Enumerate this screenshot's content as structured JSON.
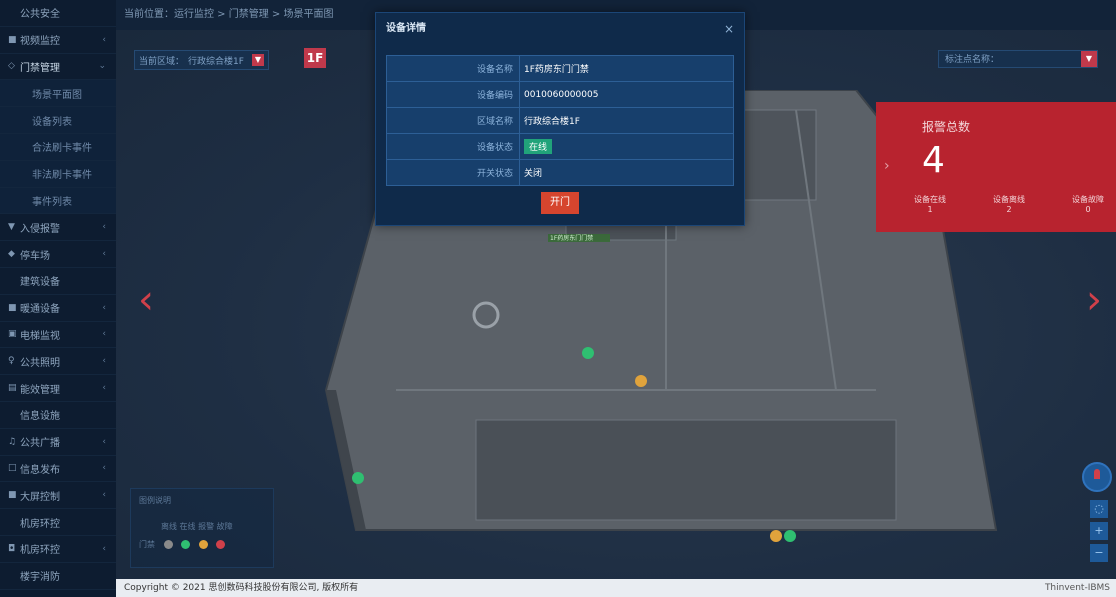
{
  "sidebar": {
    "items": [
      {
        "label": "公共安全",
        "icon": "",
        "chev": ""
      },
      {
        "label": "视频监控",
        "icon": "■",
        "chev": "‹"
      },
      {
        "label": "门禁管理",
        "icon": "◇",
        "chev": "⌄"
      },
      {
        "label": "场景平面图",
        "icon": "",
        "chev": "",
        "sub": true
      },
      {
        "label": "设备列表",
        "icon": "",
        "chev": "",
        "sub": true
      },
      {
        "label": "合法刷卡事件",
        "icon": "",
        "chev": "",
        "sub": true
      },
      {
        "label": "非法刷卡事件",
        "icon": "",
        "chev": "",
        "sub": true
      },
      {
        "label": "事件列表",
        "icon": "",
        "chev": "",
        "sub": true
      },
      {
        "label": "入侵报警",
        "icon": "▼",
        "chev": "‹"
      },
      {
        "label": "停车场",
        "icon": "◆",
        "chev": "‹"
      },
      {
        "label": "建筑设备",
        "icon": "",
        "chev": ""
      },
      {
        "label": "暖通设备",
        "icon": "■",
        "chev": "‹"
      },
      {
        "label": "电梯监视",
        "icon": "▣",
        "chev": "‹"
      },
      {
        "label": "公共照明",
        "icon": "♀",
        "chev": "‹"
      },
      {
        "label": "能效管理",
        "icon": "▤",
        "chev": "‹"
      },
      {
        "label": "信息设施",
        "icon": "",
        "chev": ""
      },
      {
        "label": "公共广播",
        "icon": "♫",
        "chev": "‹"
      },
      {
        "label": "信息发布",
        "icon": "□",
        "chev": "‹"
      },
      {
        "label": "大屏控制",
        "icon": "■",
        "chev": "‹"
      },
      {
        "label": "机房环控",
        "icon": "",
        "chev": ""
      },
      {
        "label": "机房环控",
        "icon": "◘",
        "chev": "‹"
      },
      {
        "label": "楼宇消防",
        "icon": "",
        "chev": ""
      }
    ]
  },
  "topbar": {
    "breadcrumb": "当前位置：运行监控 > 门禁管理 > 场景平面图"
  },
  "area": {
    "label": "当前区域：",
    "value": "行政综合楼1F",
    "floor": "1F"
  },
  "marker": {
    "placeholder": "标注点名称："
  },
  "alarm": {
    "title": "报警总数",
    "count": "4",
    "stats": [
      {
        "label": "设备在线",
        "value": "1"
      },
      {
        "label": "设备离线",
        "value": "2"
      },
      {
        "label": "设备故障",
        "value": "0"
      }
    ]
  },
  "legend": {
    "title": "图例说明",
    "header": "离线 在线 报警 故障",
    "row_label": "门禁",
    "colors": [
      "#8a8a8a",
      "#2fbf71",
      "#e0a33c",
      "#d0404a"
    ]
  },
  "modal": {
    "title": "设备详情",
    "rows": [
      {
        "key": "设备名称",
        "value": "1F药房东门门禁"
      },
      {
        "key": "设备编码",
        "value": "0010060000005"
      },
      {
        "key": "区域名称",
        "value": "行政综合楼1F"
      },
      {
        "key": "设备状态",
        "value": "在线",
        "badge": true
      },
      {
        "key": "开关状态",
        "value": "关闭"
      }
    ],
    "button": "开门"
  },
  "map_label": "1F药房东门门禁",
  "footer": {
    "copyright": "Copyright © 2021 思创数码科技股份有限公司, 版权所有",
    "brand": "Thinvent-IBMS"
  }
}
